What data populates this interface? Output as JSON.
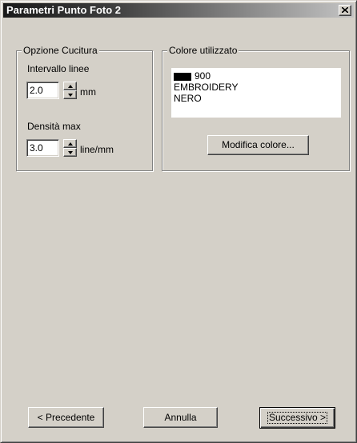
{
  "window": {
    "title": "Parametri Punto Foto 2",
    "close_icon": "close-icon"
  },
  "stitch_options": {
    "group_title": "Opzione Cucitura",
    "line_interval": {
      "label": "Intervallo linee",
      "value": "2.0",
      "unit": "mm"
    },
    "max_density": {
      "label": "Densità max",
      "value": "3.0",
      "unit": "line/mm"
    }
  },
  "color_used": {
    "group_title": "Colore utilizzato",
    "swatch_color": "#000000",
    "code": "900",
    "brand": "EMBROIDERY",
    "name": "NERO",
    "modify_button": "Modifica colore..."
  },
  "footer": {
    "back_button": "< Precedente",
    "cancel_button": "Annulla",
    "next_button": "Successivo >"
  }
}
